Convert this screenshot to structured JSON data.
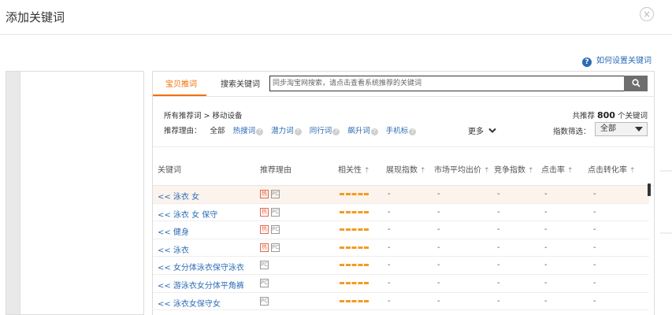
{
  "dialog": {
    "title": "添加关键词",
    "close_icon": "close-icon",
    "close_glyph": "×"
  },
  "help": {
    "icon": "?",
    "label": "如何设置关键词"
  },
  "tabs": [
    {
      "label": "宝贝推词",
      "active": true
    },
    {
      "label": "搜索关键词",
      "active": false
    }
  ],
  "search": {
    "placeholder": "同步淘宝网搜索，请点击查看系统推荐的关键词",
    "button_icon": "search-icon"
  },
  "breadcrumb": {
    "root": "所有推荐词",
    "separator": ">",
    "current": "移动设备"
  },
  "reasons": {
    "label": "推荐理由：",
    "items": [
      "全部",
      "热搜词",
      "潜力词",
      "同行词",
      "飙升词",
      "手机标"
    ],
    "more": "更多"
  },
  "summary": {
    "prefix": "共推荐",
    "count": "800",
    "suffix": "个关键词"
  },
  "index_filter": {
    "label": "指数筛选：",
    "value": "全部"
  },
  "columns": [
    "关键词",
    "推荐理由",
    "相关性",
    "展现指数",
    "市场平均出价",
    "竞争指数",
    "点击率",
    "点击转化率"
  ],
  "sort_glyph": "⇡",
  "rows": [
    {
      "keyword": "<< 泳衣 女",
      "tags": [
        "hot",
        "pc"
      ],
      "highlight": true,
      "values": [
        "-",
        "-",
        "-",
        "-",
        "-"
      ]
    },
    {
      "keyword": "<< 泳衣 女 保守",
      "tags": [
        "hot",
        "pc"
      ],
      "highlight": false,
      "values": [
        "-",
        "-",
        "-",
        "-",
        "-"
      ]
    },
    {
      "keyword": "<< 健身",
      "tags": [
        "hot",
        "pc"
      ],
      "highlight": false,
      "values": [
        "-",
        "-",
        "-",
        "-",
        "-"
      ]
    },
    {
      "keyword": "<< 泳衣",
      "tags": [
        "hot",
        "pc"
      ],
      "highlight": false,
      "values": [
        "-",
        "-",
        "-",
        "-",
        "-"
      ]
    },
    {
      "keyword": "<< 女分体泳衣保守泳衣",
      "tags": [
        "pc"
      ],
      "highlight": false,
      "values": [
        "-",
        "-",
        "-",
        "-",
        "-"
      ]
    },
    {
      "keyword": "<< 游泳衣女分体平角裤",
      "tags": [
        "pc"
      ],
      "highlight": false,
      "values": [
        "-",
        "-",
        "-",
        "-",
        "-"
      ]
    },
    {
      "keyword": "<< 泳衣女保守女",
      "tags": [
        "pc"
      ],
      "highlight": false,
      "values": [
        "-",
        "-",
        "-",
        "-",
        "-"
      ]
    }
  ],
  "tag_glyphs": {
    "hot": "热",
    "pc": "PC"
  },
  "colors": {
    "accent": "#f56e00",
    "link": "#2b6bb5",
    "relevance_bar": "#f59a23",
    "hot_tag": "#e36a4e"
  }
}
